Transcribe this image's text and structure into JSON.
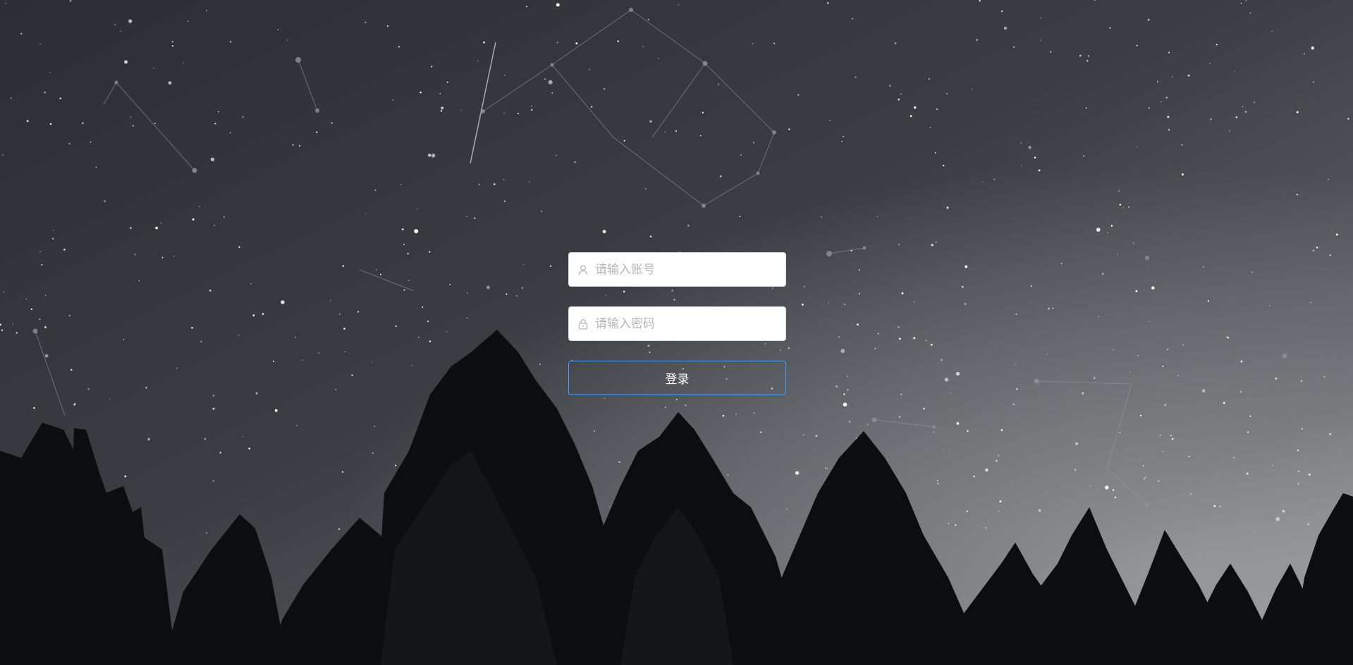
{
  "login": {
    "username": {
      "placeholder": "请输入账号",
      "value": "",
      "icon": "user-icon"
    },
    "password": {
      "placeholder": "请输入密码",
      "value": "",
      "icon": "lock-icon"
    },
    "submit_label": "登录"
  },
  "colors": {
    "button_border": "#409eff",
    "input_bg": "#ffffff",
    "placeholder": "#b4b6bc"
  },
  "background": {
    "icon": "starry-night-forest-image"
  }
}
